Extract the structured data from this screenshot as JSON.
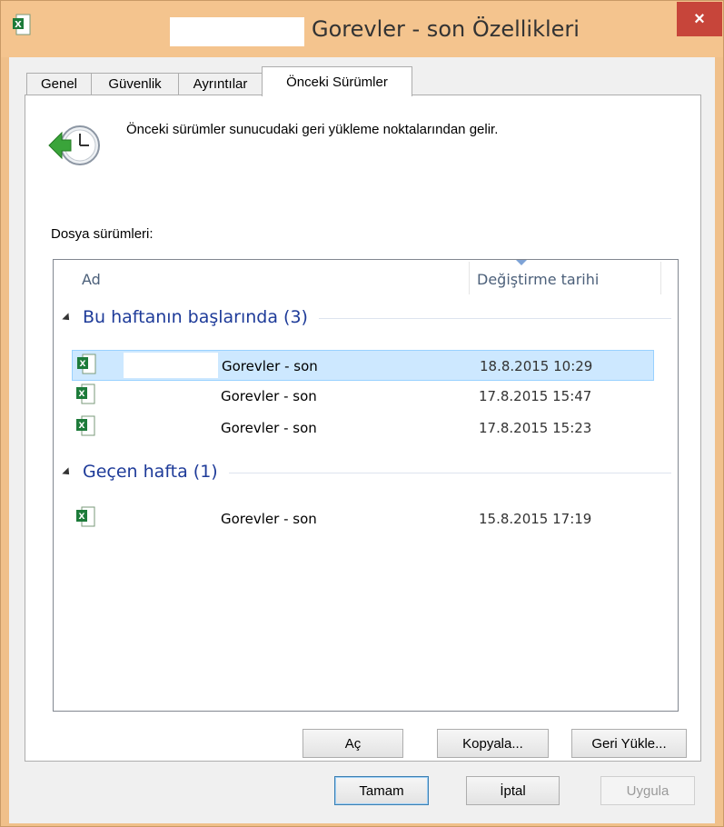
{
  "window": {
    "title": "Gorevler - son Özellikleri",
    "close_label": "×"
  },
  "tabs": [
    {
      "label": "Genel"
    },
    {
      "label": "Güvenlik"
    },
    {
      "label": "Ayrıntılar"
    },
    {
      "label": "Önceki Sürümler"
    }
  ],
  "page": {
    "info_text": "Önceki sürümler sunucudaki geri yükleme noktalarından gelir.",
    "file_versions_label": "Dosya sürümleri:"
  },
  "list": {
    "columns": [
      {
        "label": "Ad"
      },
      {
        "label": "Değiştirme tarihi"
      }
    ],
    "groups": [
      {
        "label": "Bu haftanın başlarında (3)",
        "rows": [
          {
            "name": "Gorevler - son",
            "date": "18.8.2015 10:29",
            "selected": true
          },
          {
            "name": "Gorevler - son",
            "date": "17.8.2015 15:47",
            "selected": false
          },
          {
            "name": "Gorevler - son",
            "date": "17.8.2015 15:23",
            "selected": false
          }
        ]
      },
      {
        "label": "Geçen hafta (1)",
        "rows": [
          {
            "name": "Gorevler - son",
            "date": "15.8.2015 17:19",
            "selected": false
          }
        ]
      }
    ]
  },
  "action_buttons": {
    "open": "Aç",
    "copy": "Kopyala...",
    "restore": "Geri Yükle..."
  },
  "dialog_buttons": {
    "ok": "Tamam",
    "cancel": "İptal",
    "apply": "Uygula"
  },
  "colors": {
    "title_bar": "#f4c48e",
    "close_button": "#c7453a",
    "group_header": "#1e3b99",
    "selection": "#cde8ff"
  },
  "icons": {
    "app": "excel-file-icon",
    "info": "restore-clock-icon",
    "close": "close-icon"
  }
}
